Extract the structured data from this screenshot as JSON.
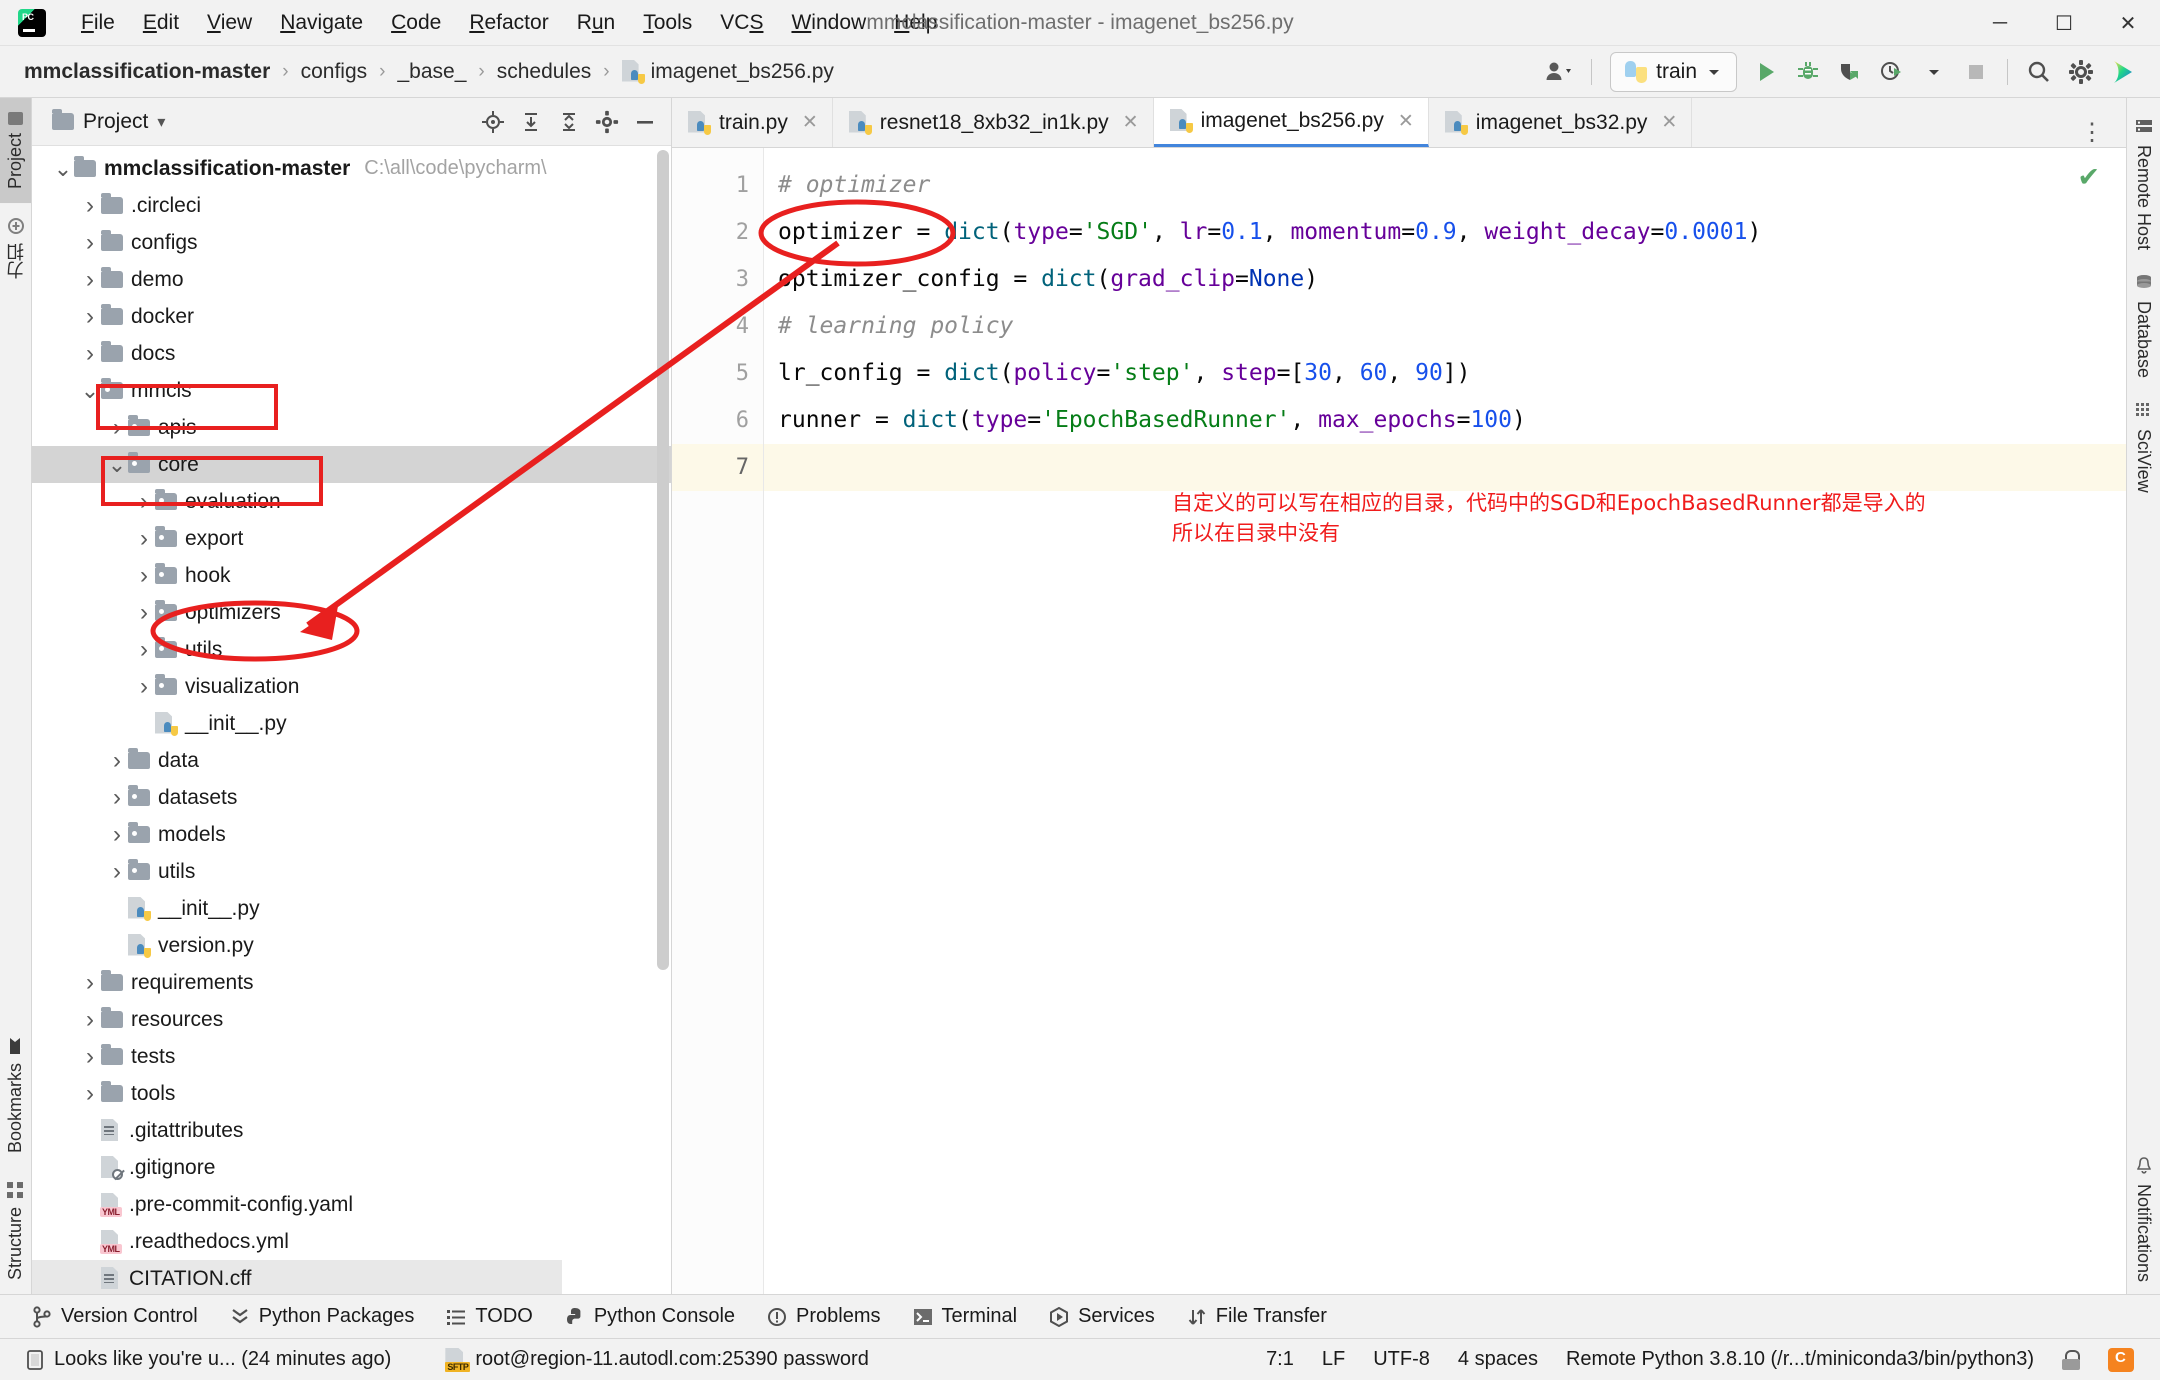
{
  "titlebar": {
    "app_icon": "pycharm-logo",
    "menus": [
      "File",
      "Edit",
      "View",
      "Navigate",
      "Code",
      "Refactor",
      "Run",
      "Tools",
      "VCS",
      "Window",
      "Help"
    ],
    "window_title": "mmclassification-master - imagenet_bs256.py",
    "minimize": "─",
    "maximize": "☐",
    "close": "✕"
  },
  "navbar": {
    "crumbs": [
      "mmclassification-master",
      "configs",
      "_base_",
      "schedules"
    ],
    "crumb_file": "imagenet_bs256.py",
    "separator": "›",
    "run_config": "train",
    "icons": {
      "account": "account-icon",
      "run": "run-icon",
      "debug": "debug-icon",
      "coverage": "coverage-icon",
      "profile": "profile-icon",
      "stop": "stop-icon",
      "search": "search-icon",
      "settings": "gear-icon",
      "assistant": "ai-assistant-icon"
    }
  },
  "rail_left": {
    "items": [
      {
        "label": "Project",
        "icon": "project-folder-icon",
        "active": true
      },
      {
        "label": "力扣",
        "icon": "plugin-icon",
        "active": false
      }
    ],
    "bottom_items": [
      {
        "label": "Bookmarks",
        "icon": "bookmark-icon"
      },
      {
        "label": "Structure",
        "icon": "structure-icon"
      }
    ]
  },
  "rail_right": {
    "items": [
      {
        "label": "Remote Host",
        "icon": "remote-host-icon"
      },
      {
        "label": "Database",
        "icon": "database-icon"
      },
      {
        "label": "SciView",
        "icon": "sciview-icon"
      }
    ],
    "bottom_items": [
      {
        "label": "Notifications",
        "icon": "notifications-icon"
      }
    ]
  },
  "project_panel": {
    "title": "Project",
    "title_caret": "▾",
    "header_buttons": [
      "locate-icon",
      "expand-all-icon",
      "collapse-all-icon",
      "gear-icon",
      "hide-icon"
    ],
    "tree": [
      {
        "indent": 0,
        "arrow": "down",
        "icon": "folder",
        "label": "mmclassification-master",
        "path": "C:\\all\\code\\pycharm\\",
        "bold": true
      },
      {
        "indent": 1,
        "arrow": "right",
        "icon": "folder",
        "label": ".circleci"
      },
      {
        "indent": 1,
        "arrow": "right",
        "icon": "folder",
        "label": "configs"
      },
      {
        "indent": 1,
        "arrow": "right",
        "icon": "folder",
        "label": "demo"
      },
      {
        "indent": 1,
        "arrow": "right",
        "icon": "folder",
        "label": "docker"
      },
      {
        "indent": 1,
        "arrow": "right",
        "icon": "folder",
        "label": "docs"
      },
      {
        "indent": 1,
        "arrow": "down",
        "icon": "folder-src",
        "label": "mmcls",
        "boxed": true
      },
      {
        "indent": 2,
        "arrow": "right",
        "icon": "folder-src",
        "label": "apis"
      },
      {
        "indent": 2,
        "arrow": "down",
        "icon": "folder-src",
        "label": "core",
        "boxed": true,
        "selected": true
      },
      {
        "indent": 3,
        "arrow": "right",
        "icon": "folder-src",
        "label": "evaluation"
      },
      {
        "indent": 3,
        "arrow": "right",
        "icon": "folder-src",
        "label": "export"
      },
      {
        "indent": 3,
        "arrow": "right",
        "icon": "folder-src",
        "label": "hook"
      },
      {
        "indent": 3,
        "arrow": "right",
        "icon": "folder-src",
        "label": "optimizers",
        "circled": true
      },
      {
        "indent": 3,
        "arrow": "right",
        "icon": "folder-src",
        "label": "utils"
      },
      {
        "indent": 3,
        "arrow": "right",
        "icon": "folder-src",
        "label": "visualization"
      },
      {
        "indent": 3,
        "arrow": "none",
        "icon": "python",
        "label": "__init__.py"
      },
      {
        "indent": 2,
        "arrow": "right",
        "icon": "folder",
        "label": "data"
      },
      {
        "indent": 2,
        "arrow": "right",
        "icon": "folder-src",
        "label": "datasets"
      },
      {
        "indent": 2,
        "arrow": "right",
        "icon": "folder-src",
        "label": "models"
      },
      {
        "indent": 2,
        "arrow": "right",
        "icon": "folder-src",
        "label": "utils"
      },
      {
        "indent": 2,
        "arrow": "none",
        "icon": "python",
        "label": "__init__.py"
      },
      {
        "indent": 2,
        "arrow": "none",
        "icon": "python",
        "label": "version.py"
      },
      {
        "indent": 1,
        "arrow": "right",
        "icon": "folder",
        "label": "requirements"
      },
      {
        "indent": 1,
        "arrow": "right",
        "icon": "folder",
        "label": "resources"
      },
      {
        "indent": 1,
        "arrow": "right",
        "icon": "folder",
        "label": "tests"
      },
      {
        "indent": 1,
        "arrow": "right",
        "icon": "folder",
        "label": "tools"
      },
      {
        "indent": 1,
        "arrow": "none",
        "icon": "textfile",
        "label": ".gitattributes"
      },
      {
        "indent": 1,
        "arrow": "none",
        "icon": "gitignore",
        "label": ".gitignore"
      },
      {
        "indent": 1,
        "arrow": "none",
        "icon": "yml",
        "label": ".pre-commit-config.yaml"
      },
      {
        "indent": 1,
        "arrow": "none",
        "icon": "yml",
        "label": ".readthedocs.yml"
      },
      {
        "indent": 1,
        "arrow": "none",
        "icon": "textfile",
        "label": "CITATION.cff",
        "clipped": true
      }
    ]
  },
  "editor": {
    "tabs": [
      {
        "label": "train.py",
        "icon": "python-file-icon",
        "active": false,
        "closable": true
      },
      {
        "label": "resnet18_8xb32_in1k.py",
        "icon": "python-file-icon",
        "active": false,
        "closable": true
      },
      {
        "label": "imagenet_bs256.py",
        "icon": "python-file-icon",
        "active": true,
        "closable": true
      },
      {
        "label": "imagenet_bs32.py",
        "icon": "python-file-icon",
        "active": false,
        "closable": true
      }
    ],
    "overflow_icon": "more-options-icon",
    "inspection_status": "✔",
    "line_numbers": [
      "1",
      "2",
      "3",
      "4",
      "5",
      "6",
      "7"
    ],
    "current_line": 7,
    "code_lines": [
      [
        {
          "t": "# optimizer",
          "c": "cm"
        }
      ],
      [
        {
          "t": "optimizer ",
          "c": "plain"
        },
        {
          "t": "= ",
          "c": "plain"
        },
        {
          "t": "dict",
          "c": "fn"
        },
        {
          "t": "(",
          "c": "plain"
        },
        {
          "t": "type",
          "c": "param"
        },
        {
          "t": "=",
          "c": "plain"
        },
        {
          "t": "'SGD'",
          "c": "str"
        },
        {
          "t": ", ",
          "c": "plain"
        },
        {
          "t": "lr",
          "c": "param"
        },
        {
          "t": "=",
          "c": "plain"
        },
        {
          "t": "0.1",
          "c": "num"
        },
        {
          "t": ", ",
          "c": "plain"
        },
        {
          "t": "momentum",
          "c": "param"
        },
        {
          "t": "=",
          "c": "plain"
        },
        {
          "t": "0.9",
          "c": "num"
        },
        {
          "t": ", ",
          "c": "plain"
        },
        {
          "t": "weight_decay",
          "c": "param"
        },
        {
          "t": "=",
          "c": "plain"
        },
        {
          "t": "0.0001",
          "c": "num"
        },
        {
          "t": ")",
          "c": "plain"
        }
      ],
      [
        {
          "t": "optimizer_config ",
          "c": "plain"
        },
        {
          "t": "= ",
          "c": "plain"
        },
        {
          "t": "dict",
          "c": "fn"
        },
        {
          "t": "(",
          "c": "plain"
        },
        {
          "t": "grad_clip",
          "c": "param"
        },
        {
          "t": "=",
          "c": "plain"
        },
        {
          "t": "None",
          "c": "kw"
        },
        {
          "t": ")",
          "c": "plain"
        }
      ],
      [
        {
          "t": "# learning policy",
          "c": "cm"
        }
      ],
      [
        {
          "t": "lr_config ",
          "c": "plain"
        },
        {
          "t": "= ",
          "c": "plain"
        },
        {
          "t": "dict",
          "c": "fn"
        },
        {
          "t": "(",
          "c": "plain"
        },
        {
          "t": "policy",
          "c": "param"
        },
        {
          "t": "=",
          "c": "plain"
        },
        {
          "t": "'step'",
          "c": "str"
        },
        {
          "t": ", ",
          "c": "plain"
        },
        {
          "t": "step",
          "c": "param"
        },
        {
          "t": "=[",
          "c": "plain"
        },
        {
          "t": "30",
          "c": "num"
        },
        {
          "t": ", ",
          "c": "plain"
        },
        {
          "t": "60",
          "c": "num"
        },
        {
          "t": ", ",
          "c": "plain"
        },
        {
          "t": "90",
          "c": "num"
        },
        {
          "t": "])",
          "c": "plain"
        }
      ],
      [
        {
          "t": "runner ",
          "c": "plain"
        },
        {
          "t": "= ",
          "c": "plain"
        },
        {
          "t": "dict",
          "c": "fn"
        },
        {
          "t": "(",
          "c": "plain"
        },
        {
          "t": "type",
          "c": "param"
        },
        {
          "t": "=",
          "c": "plain"
        },
        {
          "t": "'EpochBasedRunner'",
          "c": "str"
        },
        {
          "t": ", ",
          "c": "plain"
        },
        {
          "t": "max_epochs",
          "c": "param"
        },
        {
          "t": "=",
          "c": "plain"
        },
        {
          "t": "100",
          "c": "num"
        },
        {
          "t": ")",
          "c": "plain"
        }
      ],
      []
    ],
    "annotation_note": "自定义的可以写在相应的目录，代码中的SGD和EpochBasedRunner都是导入的\n所以在目录中没有"
  },
  "annotations": {
    "color": "#e8201f",
    "shapes": [
      "ellipse-optimizer-code",
      "ellipse-optimizers-folder",
      "rect-mmcls",
      "rect-core",
      "arrow-code-to-folder"
    ]
  },
  "toolwindow_bar": {
    "items": [
      {
        "label": "Version Control",
        "icon": "branch-icon"
      },
      {
        "label": "Python Packages",
        "icon": "packages-icon"
      },
      {
        "label": "TODO",
        "icon": "todo-icon"
      },
      {
        "label": "Python Console",
        "icon": "python-console-icon"
      },
      {
        "label": "Problems",
        "icon": "problems-icon"
      },
      {
        "label": "Terminal",
        "icon": "terminal-icon"
      },
      {
        "label": "Services",
        "icon": "services-icon"
      },
      {
        "label": "File Transfer",
        "icon": "file-transfer-icon"
      }
    ]
  },
  "statusbar": {
    "message": "Looks like you're u... (24 minutes ago)",
    "message_icon": "event-log-icon",
    "sftp_icon": "sftp-icon",
    "remote": "root@region-11.autodl.com:25390 password",
    "caret": "7:1",
    "line_ending": "LF",
    "encoding": "UTF-8",
    "indent": "4 spaces",
    "interpreter": "Remote Python 3.8.10 (/r...t/miniconda3/bin/python3)",
    "lock_icon": "lock-icon",
    "watermark": "csdn-watermark"
  }
}
